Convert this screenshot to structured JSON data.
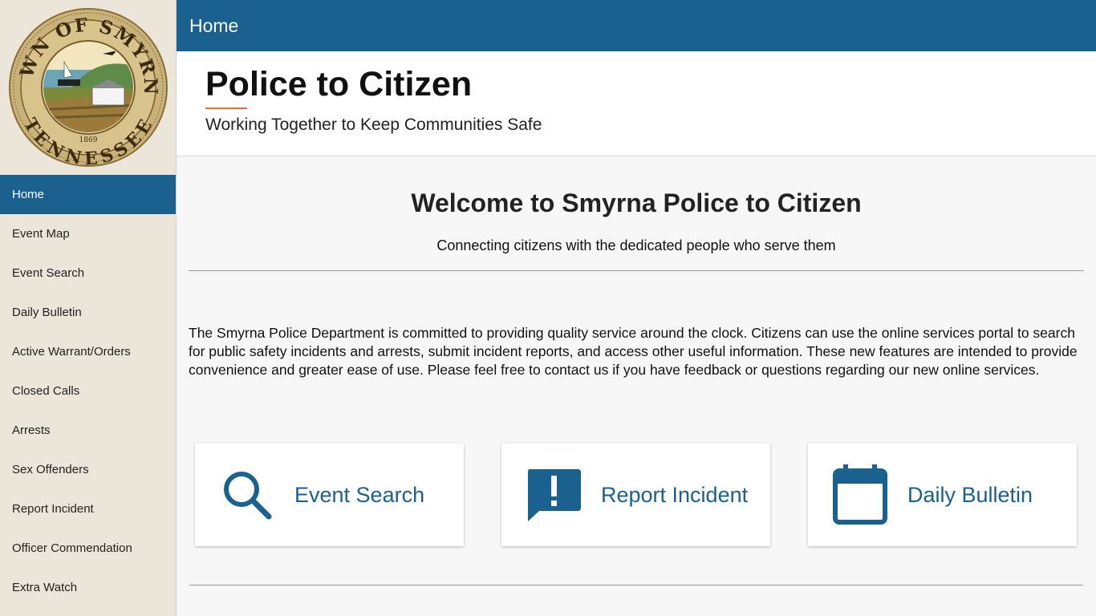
{
  "seal": {
    "top_text": "TOWN OF SMYRNA",
    "bottom_text": "TENNESSEE",
    "year": "1869"
  },
  "sidebar": {
    "items": [
      {
        "label": "Home",
        "active": true
      },
      {
        "label": "Event Map"
      },
      {
        "label": "Event Search"
      },
      {
        "label": "Daily Bulletin"
      },
      {
        "label": "Active Warrant/Orders"
      },
      {
        "label": "Closed Calls"
      },
      {
        "label": "Arrests"
      },
      {
        "label": "Sex Offenders"
      },
      {
        "label": "Report Incident"
      },
      {
        "label": "Officer Commendation"
      },
      {
        "label": "Extra Watch"
      }
    ]
  },
  "topbar": {
    "title": "Home"
  },
  "header": {
    "title": "Police to Citizen",
    "subtitle": "Working Together to Keep Communities Safe"
  },
  "main": {
    "welcome": "Welcome to Smyrna Police to Citizen",
    "tagline": "Connecting citizens with the dedicated people who serve them",
    "intro": "The Smyrna Police Department is committed to providing quality service around the clock. Citizens can use the online services portal to search for public safety incidents and arrests, submit incident reports, and access other useful information. These new features are intended to provide convenience and greater ease of use. Please feel free to contact us if you have feedback or questions regarding our new online services.",
    "cards": [
      {
        "label": "Event Search",
        "icon": "search-icon"
      },
      {
        "label": "Report Incident",
        "icon": "report-incident-icon"
      },
      {
        "label": "Daily Bulletin",
        "icon": "calendar-icon"
      }
    ]
  },
  "colors": {
    "primary": "#1a6190",
    "sidebar_bg": "#ece6da",
    "accent": "#e2703a",
    "page_bg": "#f7f7f7"
  }
}
